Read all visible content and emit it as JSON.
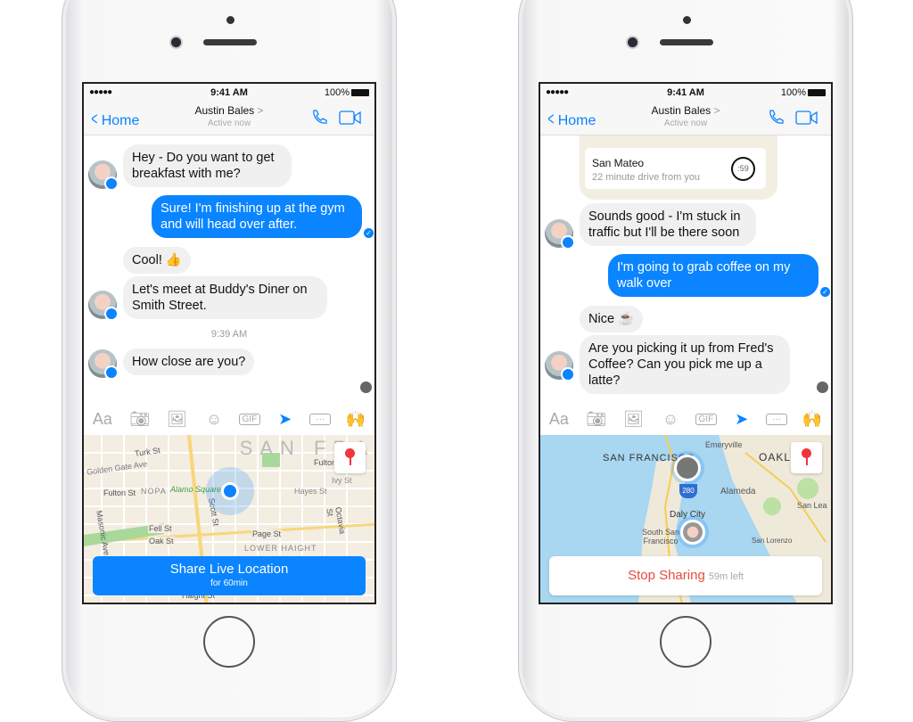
{
  "status": {
    "signal": "●●●●●",
    "time": "9:41 AM",
    "battery": "100%"
  },
  "nav": {
    "back": "Home",
    "contact": "Austin Bales",
    "contact_chevron": ">",
    "presence": "Active now"
  },
  "toolbar": {
    "text": "Aa",
    "icons": [
      "camera-icon",
      "photo-icon",
      "emoji-icon",
      "gif-icon",
      "location-icon",
      "more-icon",
      "reaction-icon"
    ],
    "gif": "GIF",
    "more": "···",
    "reaction": "🙌"
  },
  "colors": {
    "accent": "#0a84ff",
    "stop": "#e74c3c",
    "bubble_in": "#f1f0f0"
  },
  "phone1": {
    "messages": [
      {
        "from": "them",
        "text": "Hey - Do you want to get breakfast with me?"
      },
      {
        "from": "me",
        "text": "Sure! I'm finishing up at the gym and will head over after."
      },
      {
        "from": "them",
        "text": "Cool! 👍"
      },
      {
        "from": "them",
        "text": "Let's meet at Buddy's Diner on Smith Street."
      },
      {
        "from": "them",
        "text": "How close are you?"
      }
    ],
    "timestamp": "9:39 AM",
    "map_labels": [
      "SAN FRA",
      "Turk St",
      "Golden Gate Ave",
      "Fulton St",
      "NOPA",
      "Alamo Square",
      "Fulton",
      "Ivy St",
      "Hayes St",
      "Masonic Ave",
      "Fell St",
      "Oak St",
      "Scott St",
      "Page St",
      "Octavia St",
      "LOWER HAIGHT",
      "Haight St"
    ],
    "share": {
      "label": "Share Live Location",
      "duration": "for 60min"
    }
  },
  "phone2": {
    "location_card": {
      "place": "San Mateo",
      "detail": "22 minute drive from you",
      "timer": ":59"
    },
    "messages": [
      {
        "from": "them",
        "text": "Sounds good - I'm stuck in traffic but I'll be there soon"
      },
      {
        "from": "me",
        "text": "I'm going to grab coffee on my walk over"
      },
      {
        "from": "them",
        "text": "Nice ☕"
      },
      {
        "from": "them",
        "text": "Are you picking it up from Fred's Coffee? Can you pick me up a latte?"
      }
    ],
    "map_labels": [
      "SAN FRANCISCO",
      "Emeryville",
      "OAKLA",
      "Alameda",
      "280",
      "Daly City",
      "South San Francisco",
      "San Lea",
      "San Lorenzo"
    ],
    "stop": {
      "label": "Stop Sharing",
      "remaining": "59m left"
    }
  }
}
